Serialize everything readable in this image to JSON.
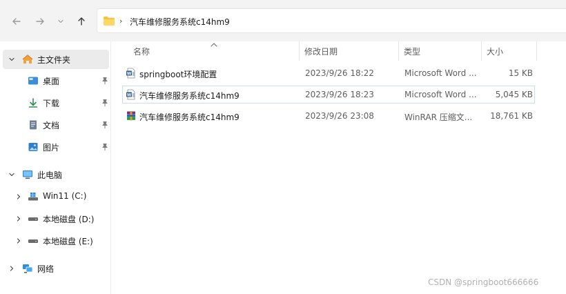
{
  "toolbar": {
    "back_icon": "arrow-left-icon",
    "forward_icon": "arrow-right-icon",
    "recent_icon": "chevron-down-icon",
    "up_icon": "arrow-up-icon"
  },
  "address": {
    "separator": "›",
    "crumb": "汽车维修服务系统c14hm9"
  },
  "sidebar": {
    "items": [
      {
        "label": "主文件夹",
        "icon": "home-icon"
      },
      {
        "label": "桌面",
        "icon": "desktop-icon"
      },
      {
        "label": "下载",
        "icon": "download-icon"
      },
      {
        "label": "文档",
        "icon": "document-icon"
      },
      {
        "label": "图片",
        "icon": "picture-icon"
      },
      {
        "label": "此电脑",
        "icon": "computer-icon"
      },
      {
        "label": "Win11 (C:)",
        "icon": "windows-drive-icon"
      },
      {
        "label": "本地磁盘 (D:)",
        "icon": "drive-icon"
      },
      {
        "label": "本地磁盘 (E:)",
        "icon": "drive-icon"
      },
      {
        "label": "网络",
        "icon": "network-icon"
      }
    ]
  },
  "columns": {
    "name": "名称",
    "modified": "修改日期",
    "type": "类型",
    "size": "大小"
  },
  "files": [
    {
      "name": "springboot环境配置",
      "modified": "2023/9/26 18:22",
      "type": "Microsoft Word ...",
      "size": "15 KB",
      "icon": "word-doc-icon"
    },
    {
      "name": "汽车维修服务系统c14hm9",
      "modified": "2023/9/26 18:23",
      "type": "Microsoft Word ...",
      "size": "5,045 KB",
      "icon": "word-doc-icon"
    },
    {
      "name": "汽车维修服务系统c14hm9",
      "modified": "2023/9/26 23:08",
      "type": "WinRAR 压缩文...",
      "size": "18,761 KB",
      "icon": "winrar-archive-icon"
    }
  ],
  "watermark": "CSDN @springboot666666",
  "colors": {
    "accent": "#0067c0",
    "folder": "#f5c342",
    "selection_border": "#c8dff2"
  }
}
